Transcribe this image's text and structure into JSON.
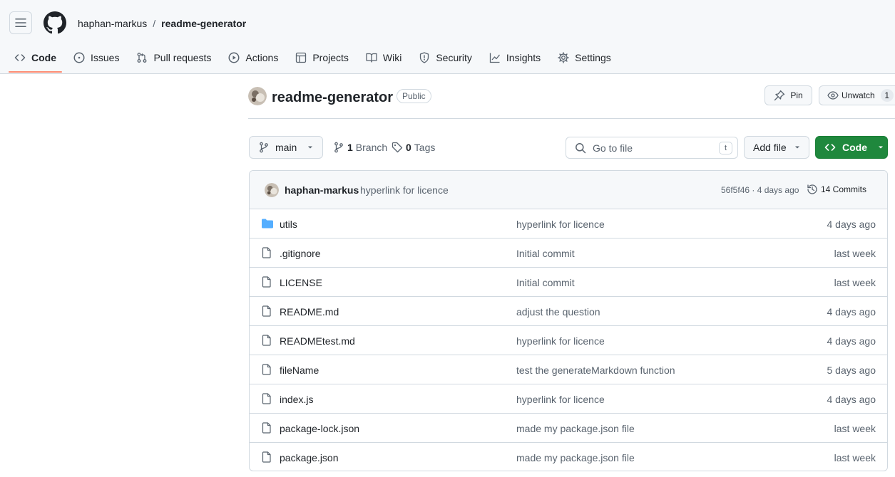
{
  "breadcrumb": {
    "owner": "haphan-markus",
    "separator": "/",
    "repo": "readme-generator"
  },
  "tabs": [
    {
      "label": "Code",
      "icon": "code-icon"
    },
    {
      "label": "Issues",
      "icon": "issue-opened-icon"
    },
    {
      "label": "Pull requests",
      "icon": "pull-request-icon"
    },
    {
      "label": "Actions",
      "icon": "play-icon"
    },
    {
      "label": "Projects",
      "icon": "table-icon"
    },
    {
      "label": "Wiki",
      "icon": "book-icon"
    },
    {
      "label": "Security",
      "icon": "shield-icon"
    },
    {
      "label": "Insights",
      "icon": "graph-icon"
    },
    {
      "label": "Settings",
      "icon": "gear-icon"
    }
  ],
  "active_tab": "Code",
  "repo": {
    "name": "readme-generator",
    "visibility": "Public",
    "pin_label": "Pin",
    "watch_label": "Unwatch",
    "watch_count": "1"
  },
  "toolbar": {
    "branch": "main",
    "branches_count": "1",
    "branches_label": "Branch",
    "tags_count": "0",
    "tags_label": "Tags",
    "search_placeholder": "Go to file",
    "search_shortcut": "t",
    "add_file_label": "Add file",
    "code_label": "Code"
  },
  "latest_commit": {
    "author": "haphan-markus",
    "message": "hyperlink for licence",
    "sha_and_age": "56f5f46 · 4 days ago",
    "commits_label": "14 Commits"
  },
  "files": [
    {
      "name": "utils",
      "type": "folder",
      "message": "hyperlink for licence",
      "age": "4 days ago"
    },
    {
      "name": ".gitignore",
      "type": "file",
      "message": "Initial commit",
      "age": "last week"
    },
    {
      "name": "LICENSE",
      "type": "file",
      "message": "Initial commit",
      "age": "last week"
    },
    {
      "name": "README.md",
      "type": "file",
      "message": "adjust the question",
      "age": "4 days ago"
    },
    {
      "name": "READMEtest.md",
      "type": "file",
      "message": "hyperlink for licence",
      "age": "4 days ago"
    },
    {
      "name": "fileName",
      "type": "file",
      "message": "test the generateMarkdown function",
      "age": "5 days ago"
    },
    {
      "name": "index.js",
      "type": "file",
      "message": "hyperlink for licence",
      "age": "4 days ago"
    },
    {
      "name": "package-lock.json",
      "type": "file",
      "message": "made my package.json file",
      "age": "last week"
    },
    {
      "name": "package.json",
      "type": "file",
      "message": "made my package.json file",
      "age": "last week"
    }
  ],
  "colors": {
    "accent_green": "#1f883d",
    "active_tab_underline": "#fd8c73",
    "folder_blue": "#54aeff"
  }
}
